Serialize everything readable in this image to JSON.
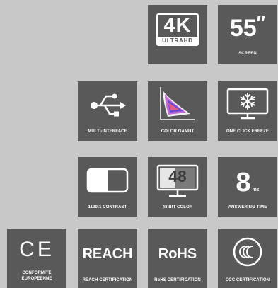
{
  "colors": {
    "background": "#c8c8c8",
    "tile": "#595959",
    "foreground": "#ffffff"
  },
  "tiles": {
    "uhd": {
      "big": "4K",
      "small": "ULTRAHD",
      "icon": "4k-ultrahd-badge-icon"
    },
    "screen": {
      "value": "55",
      "unit": "″",
      "caption": "SCREEN"
    },
    "interface": {
      "caption": "MULTI-INTERFACE",
      "icon": "usb-icon"
    },
    "gamut": {
      "caption": "COLOR GAMUT",
      "icon": "color-gamut-icon"
    },
    "freeze": {
      "caption": "ONE CLICK FREEZE",
      "icon": "snowflake-monitor-icon"
    },
    "contrast": {
      "caption": "1100:1  CONTRAST",
      "icon": "contrast-icon"
    },
    "bitcolor": {
      "value": "48",
      "caption_prefix": "48 ",
      "caption_bold": "BIT COLOR",
      "icon": "monitor-icon"
    },
    "response": {
      "value": "8",
      "unit": "ms",
      "caption": "ANSWERING TIME"
    },
    "ce": {
      "mark": "CE",
      "caption_line1": "CONFORMITE",
      "caption_line2": "EUROPEENNE"
    },
    "reach": {
      "mark": "REACH",
      "caption": "REACH CERTIFICATION"
    },
    "rohs": {
      "mark": "RoHS",
      "caption": "RoHS CERTIFICATION"
    },
    "ccc": {
      "caption": "CCC CERTIFICATION",
      "icon": "ccc-logo-icon"
    }
  }
}
